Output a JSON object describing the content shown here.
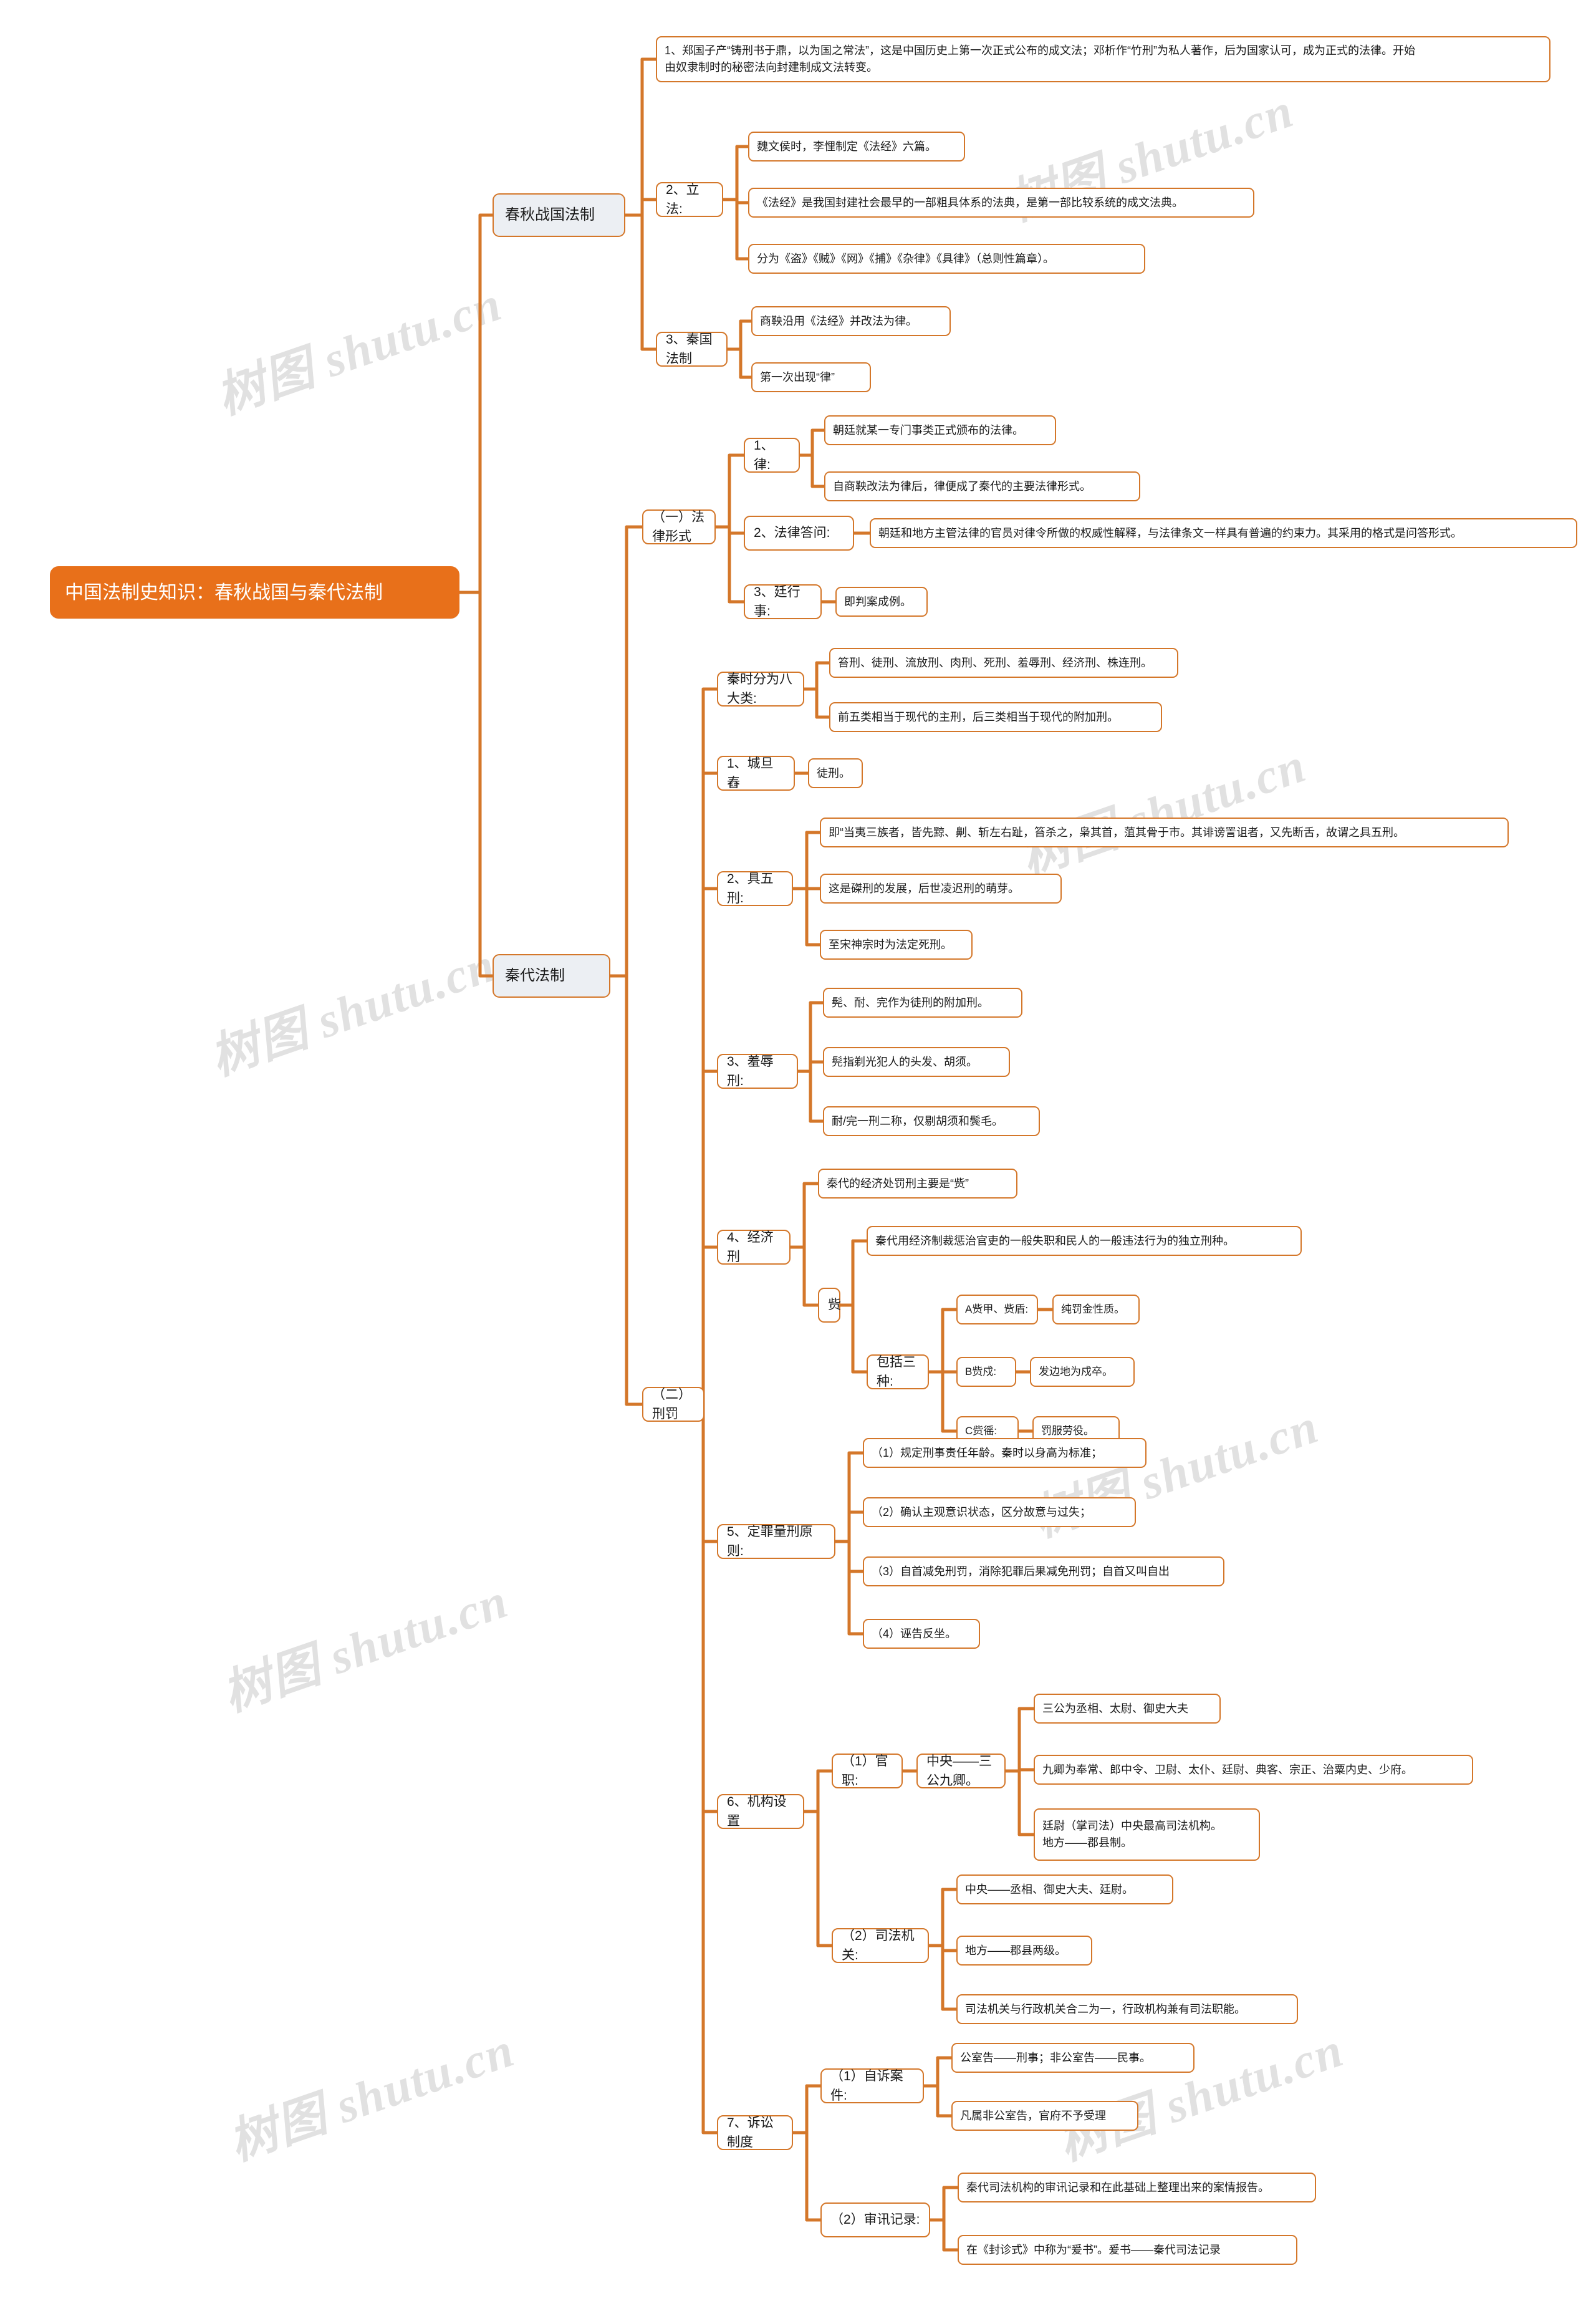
{
  "meta": {
    "title": "中国法制史知识：春秋战国与秦代法制",
    "accent": "#d4772a",
    "root_fill": "#e8701a",
    "level2_fill": "#eceff3",
    "watermark_text": "树图 shutu.cn"
  },
  "root": {
    "label": "中国法制史知识：春秋战国与秦代法制"
  },
  "branches": {
    "b1": {
      "label": "春秋战国法制"
    },
    "b2": {
      "label": "秦代法制"
    }
  },
  "nodes": {
    "n_chunqiu_1": {
      "label": "1、郑国子产“铸刑书于鼎，以为国之常法”，这是中国历史上第一次正式公布的成文法；邓析作“竹刑”为私人著作，后为国家认可，成为正式的法律。开始\n由奴隶制时的秘密法向封建制成文法转变。"
    },
    "n_lifa": {
      "label": "2、立法:"
    },
    "n_lifa_a": {
      "label": "魏文侯时，李悝制定《法经》六篇。"
    },
    "n_lifa_b": {
      "label": "《法经》是我国封建社会最早的一部粗具体系的法典，是第一部比较系统的成文法典。"
    },
    "n_lifa_c": {
      "label": "分为《盗》《贼》《网》《捕》《杂律》《具律》（总则性篇章）。"
    },
    "n_qinguo": {
      "label": "3、秦国法制"
    },
    "n_qinguo_a": {
      "label": "商鞅沿用《法经》并改法为律。"
    },
    "n_qinguo_b": {
      "label": "第一次出现“律”"
    },
    "n_falv_xingshi": {
      "label": "（一）法律形式"
    },
    "n_lv": {
      "label": "1、律:"
    },
    "n_lv_a": {
      "label": "朝廷就某一专门事类正式颁布的法律。"
    },
    "n_lv_b": {
      "label": "自商鞅改法为律后，律便成了秦代的主要法律形式。"
    },
    "n_falvdawen": {
      "label": "2、法律答问:"
    },
    "n_falvdawen_a": {
      "label": "朝廷和地方主管法律的官员对律令所做的权威性解释，与法律条文一样具有普遍的约束力。其采用的格式是问答形式。"
    },
    "n_tingxingshi": {
      "label": "3、廷行事:"
    },
    "n_tingxingshi_a": {
      "label": "即判案成例。"
    },
    "n_xingfa": {
      "label": "（二）刑罚"
    },
    "n_badalei": {
      "label": "秦时分为八大类:"
    },
    "n_badalei_a": {
      "label": "笞刑、徒刑、流放刑、肉刑、死刑、羞辱刑、经济刑、株连刑。"
    },
    "n_badalei_b": {
      "label": "前五类相当于现代的主刑，后三类相当于现代的附加刑。"
    },
    "n_chengdanchong": {
      "label": "1、城旦舂"
    },
    "n_chengdanchong_a": {
      "label": "徒刑。"
    },
    "n_juwuxing": {
      "label": "2、具五刑:"
    },
    "n_juwuxing_a": {
      "label": "即“当夷三族者，皆先黥、劓、斩左右趾，笞杀之，枭其首，菹其骨于市。其诽谤詈诅者，又先断舌，故谓之具五刑。"
    },
    "n_juwuxing_b": {
      "label": "这是磔刑的发展，后世凌迟刑的萌芽。"
    },
    "n_juwuxing_c": {
      "label": "至宋神宗时为法定死刑。"
    },
    "n_xiuruxing": {
      "label": "3、羞辱刑:"
    },
    "n_xiuruxing_a": {
      "label": "髡、耐、完作为徒刑的附加刑。"
    },
    "n_xiuruxing_b": {
      "label": "髡指剃光犯人的头发、胡须。"
    },
    "n_xiuruxing_c": {
      "label": "耐/完一刑二称，仅剔胡须和鬓毛。"
    },
    "n_jingjixing": {
      "label": "4、经济刑"
    },
    "n_jingjixing_a": {
      "label": "秦代的经济处罚刑主要是“赀”"
    },
    "n_zi": {
      "label": "赀"
    },
    "n_zi_a": {
      "label": "秦代用经济制裁惩治官吏的一般失职和民人的一般违法行为的独立刑种。"
    },
    "n_zi_b": {
      "label": "包括三种:"
    },
    "n_zi_b1": {
      "label": "A赀甲、赀盾:"
    },
    "n_zi_b1_x": {
      "label": "纯罚金性质。"
    },
    "n_zi_b2": {
      "label": "B赀戍:"
    },
    "n_zi_b2_x": {
      "label": "发边地为戍卒。"
    },
    "n_zi_b3": {
      "label": "C赀徭:"
    },
    "n_zi_b3_x": {
      "label": "罚服劳役。"
    },
    "n_dingzui": {
      "label": "5、定罪量刑原则:"
    },
    "n_dingzui_1": {
      "label": "（1）规定刑事责任年龄。秦时以身高为标准；"
    },
    "n_dingzui_2": {
      "label": "（2）确认主观意识状态，区分故意与过失；"
    },
    "n_dingzui_3": {
      "label": "（3）自首减免刑罚，消除犯罪后果减免刑罚；自首又叫自出"
    },
    "n_dingzui_4": {
      "label": "（4）诬告反坐。"
    },
    "n_jigou": {
      "label": "6、机构设置"
    },
    "n_guanzhi": {
      "label": "（1）官职:"
    },
    "n_guanzhi_a": {
      "label": "中央——三公九卿。"
    },
    "n_guanzhi_a1": {
      "label": "三公为丞相、太尉、御史大夫"
    },
    "n_guanzhi_a2": {
      "label": "九卿为奉常、郎中令、卫尉、太仆、廷尉、典客、宗正、治粟内史、少府。"
    },
    "n_guanzhi_a3": {
      "label": "廷尉（掌司法）中央最高司法机构。\n地方——郡县制。"
    },
    "n_sifa": {
      "label": "（2）司法机关:"
    },
    "n_sifa_a": {
      "label": "中央——丞相、御史大夫、廷尉。"
    },
    "n_sifa_b": {
      "label": "地方——郡县两级。"
    },
    "n_sifa_c": {
      "label": "司法机关与行政机关合二为一，行政机构兼有司法职能。"
    },
    "n_susong": {
      "label": "7、诉讼制度"
    },
    "n_zisu": {
      "label": "（1）自诉案件:"
    },
    "n_zisu_a": {
      "label": "公室告——刑事；非公室告——民事。"
    },
    "n_zisu_b": {
      "label": "凡属非公室告，官府不予受理"
    },
    "n_shenxun": {
      "label": "（2）审讯记录:"
    },
    "n_shenxun_a": {
      "label": "秦代司法机构的审讯记录和在此基础上整理出来的案情报告。"
    },
    "n_shenxun_b": {
      "label": "在《封诊式》中称为“爰书”。爰书——秦代司法记录"
    }
  }
}
